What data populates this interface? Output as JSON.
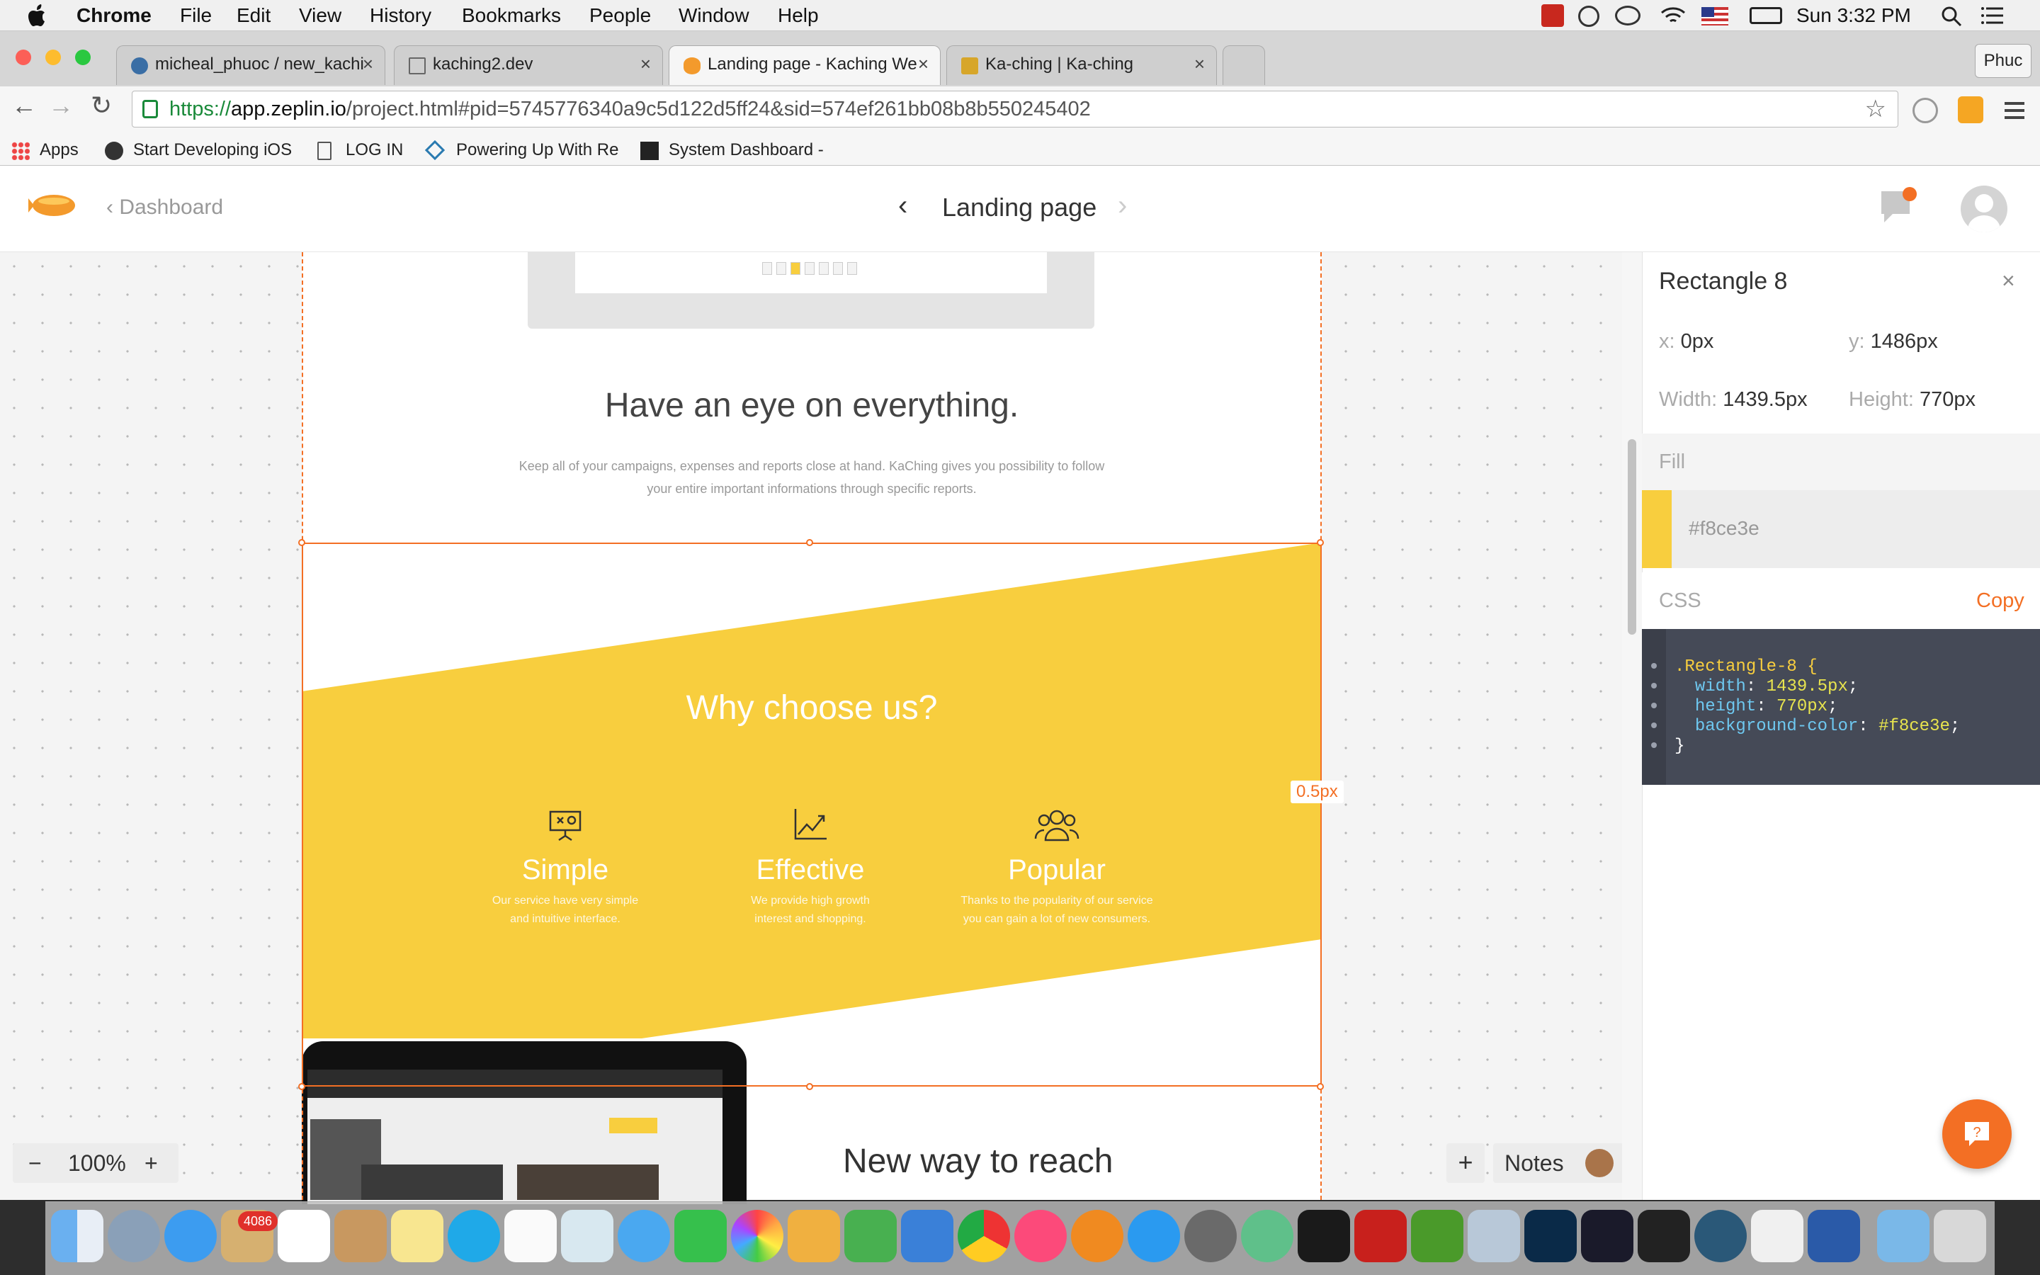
{
  "menubar": {
    "app": "Chrome",
    "items": [
      "File",
      "Edit",
      "View",
      "History",
      "Bookmarks",
      "People",
      "Window",
      "Help"
    ],
    "clock": "Sun 3:32 PM"
  },
  "tabs": [
    {
      "label": "micheal_phuoc / new_kachi"
    },
    {
      "label": "kaching2.dev"
    },
    {
      "label": "Landing page - Kaching We"
    },
    {
      "label": "Ka-ching | Ka-ching"
    }
  ],
  "profile": "Phuc",
  "url": {
    "scheme": "https://",
    "host": "app.zeplin.io",
    "path": "/project.html#pid=5745776340a9c5d122d5ff24&sid=574ef261bb08b8b550245402"
  },
  "bookmarks": [
    "Apps",
    "Start Developing iOS",
    "LOG IN",
    "Powering Up With Re",
    "System Dashboard -"
  ],
  "zeplin": {
    "back_label": "Dashboard",
    "page_title": "Landing page",
    "zoom": "100%",
    "notes_label": "Notes"
  },
  "design": {
    "headline": "Have an eye on everything.",
    "sub1": "Keep all of your campaigns, expenses and reports close at hand. KaChing gives you possibility to follow",
    "sub2": "your entire important informations through specific reports.",
    "why": "Why choose us?",
    "features": [
      {
        "title": "Simple",
        "d1": "Our service have very simple",
        "d2": "and intuitive interface."
      },
      {
        "title": "Effective",
        "d1": "We provide high growth",
        "d2": "interest and shopping."
      },
      {
        "title": "Popular",
        "d1": "Thanks to the popularity of our service",
        "d2": "you can gain a lot of new consumers."
      }
    ],
    "newway": "New way to reach",
    "distance": "0.5px"
  },
  "panel": {
    "title": "Rectangle 8",
    "x_k": "x:",
    "x_v": "0px",
    "y_k": "y:",
    "y_v": "1486px",
    "w_k": "Width:",
    "w_v": "1439.5px",
    "h_k": "Height:",
    "h_v": "770px",
    "fill_h": "Fill",
    "fill_hex": "#f8ce3e",
    "css_h": "CSS",
    "copy": "Copy",
    "code": {
      "l1": ".Rectangle-8 {",
      "l2k": "width",
      "l2v": "1439.5px",
      "l3k": "height",
      "l3v": "770px",
      "l4k": "background-color",
      "l4v": "#f8ce3e",
      "l5": "}"
    }
  },
  "dock": {
    "mail_badge": "4086"
  },
  "colors": {
    "accent": "#f36f24",
    "fill": "#f8ce3e"
  }
}
